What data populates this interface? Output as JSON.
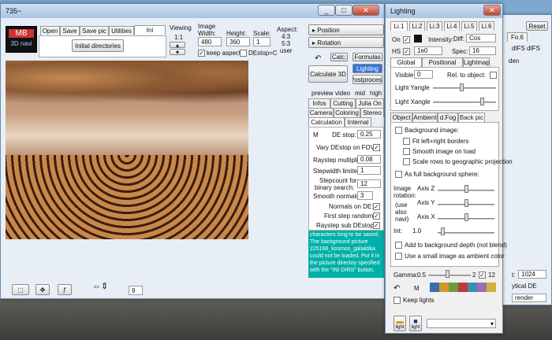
{
  "main": {
    "title": "735~",
    "tabs": [
      "Open",
      "Save",
      "Save pic",
      "Utilities",
      "Ini"
    ],
    "logo_top": "MB",
    "logo_bottom": "3D navi",
    "initial_dirs": "Initial directories",
    "viewing": {
      "label": "Viewing",
      "value": "1:1"
    },
    "image": {
      "label": "Image",
      "width_label": "Width:",
      "width": "480",
      "height_label": "Height:",
      "height": "360",
      "scale_label": "Scale:",
      "scale": "1",
      "aspect_label": "Aspect:",
      "aspect1": "4:3",
      "aspect2": "5:3",
      "aspect3": "user",
      "keep_aspect": "keep aspect",
      "destop_c": "DEstop=C"
    },
    "bottom": {
      "zoom": "9"
    }
  },
  "right": {
    "position": "Position",
    "rotation": "Rotation",
    "calc_label": "Calc:",
    "formulas": "Formulas",
    "lighting": "Lighting",
    "postprocess": "Postprocess",
    "calculate_3d": "Calculate 3D",
    "preview": [
      "preview",
      "video",
      "mid",
      "high"
    ],
    "tabs_row1": [
      "Infos",
      "Cutting",
      "Julia On"
    ],
    "tabs_row2": [
      "Camera",
      "Coloring",
      "Stereo"
    ],
    "tabs_row3": [
      "Calculation",
      "Internal"
    ],
    "m": "M",
    "de_stop": {
      "label": "DE stop:",
      "value": "0.25"
    },
    "vary": "Vary DEstop on FOV:",
    "raystep": {
      "label": "Raystep multiplier:",
      "value": "0.08"
    },
    "stepwidth": {
      "label": "Stepwidth limiter:",
      "value": "1"
    },
    "stepcount": {
      "label1": "Stepcount for",
      "label2": "binary search:",
      "value": "12"
    },
    "smooth": {
      "label": "Smooth normals:",
      "value": "3"
    },
    "normals": "Normals on DE:",
    "first_step": "First step random:",
    "raystep_sub": "Raystep sub DEstop:",
    "message": "characters long to be saved. The background picture 225166_kosmos_galaktika could not be loaded. Put it in the picture directoy specified with the \"INI DIRS\" button."
  },
  "far": {
    "tab": "Fo.6",
    "reset": "Reset",
    "difs": "dIFS dIFS",
    "den": "den",
    "t_label": "t:",
    "t_value": "1024",
    "ytical": "ytical DE",
    "render": "render"
  },
  "lighting": {
    "title": "Lighting",
    "light_tabs": [
      "Li.1",
      "Li.2",
      "Li.3",
      "Li.4",
      "Li.5",
      "Li.6"
    ],
    "on": "On",
    "intensity": "Intensity:",
    "diff": "Diff:",
    "diff_val": "Cos",
    "hs": "HS",
    "hs_val": "1e0",
    "spec": "Spec:",
    "spec_val": "16",
    "sub_tabs": [
      "Global light",
      "Positional light",
      "Lightmap"
    ],
    "visible": "Visible:",
    "visible_val": "0",
    "rel": "Rel. to object:",
    "light_y": "Light Yangle",
    "light_x": "Light Xangle",
    "bg_tabs": [
      "Object",
      "Ambient",
      "d.Fog",
      "Back pic"
    ],
    "bg_image": "Background image:",
    "fit": "Fit left+right borders",
    "smooth": "Smooth image on load",
    "scale_rows": "Scale rows to geographic projection",
    "full_sphere": "As full background sphere:",
    "image_rotation": [
      "Image",
      "rotation:",
      "(use",
      "also",
      "navi)"
    ],
    "axis_z": "Axis Z",
    "axis_y": "Axis Y",
    "axis_x": "Axis X",
    "int": "Int:",
    "int_val": "1.0",
    "add_depth": "Add to background depth (not blend)",
    "small_image": "Use a small image as ambient color",
    "gamma": "Gamma:",
    "gamma_val": "0.5",
    "gamma_max": "2",
    "gamma_num": "12",
    "m": "M",
    "keep_lights": "Keep lights",
    "light1": "light",
    "light2": "light"
  },
  "colors": {
    "accent": "#316ac5",
    "message_bg": "#00b0a8",
    "lighting_btn": "#3875d7"
  }
}
